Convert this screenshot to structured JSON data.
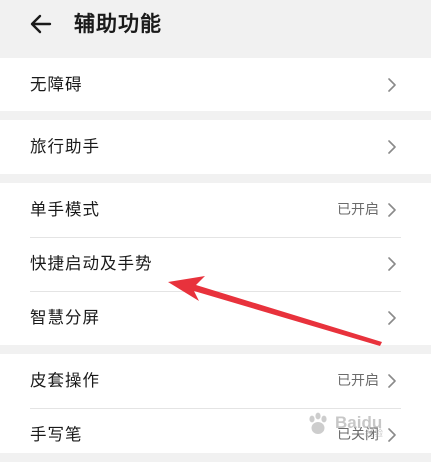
{
  "header": {
    "title": "辅助功能",
    "back_icon": "back-arrow-icon"
  },
  "sections": [
    {
      "items": [
        {
          "label": "无障碍",
          "value": ""
        }
      ]
    },
    {
      "items": [
        {
          "label": "旅行助手",
          "value": ""
        }
      ]
    },
    {
      "items": [
        {
          "label": "单手模式",
          "value": "已开启"
        },
        {
          "label": "快捷启动及手势",
          "value": ""
        },
        {
          "label": "智慧分屏",
          "value": ""
        }
      ]
    },
    {
      "items": [
        {
          "label": "皮套操作",
          "value": "已开启"
        },
        {
          "label": "手写笔",
          "value": "已关闭"
        }
      ]
    }
  ],
  "annotation": {
    "color": "#e8323c"
  },
  "watermark": {
    "text": "Baidu",
    "sub": "经验"
  },
  "colors": {
    "background": "#f1f1f1",
    "card": "#ffffff",
    "text_primary": "#1a1a1a",
    "text_secondary": "#6b6b6b",
    "divider": "#e4e4e4"
  }
}
